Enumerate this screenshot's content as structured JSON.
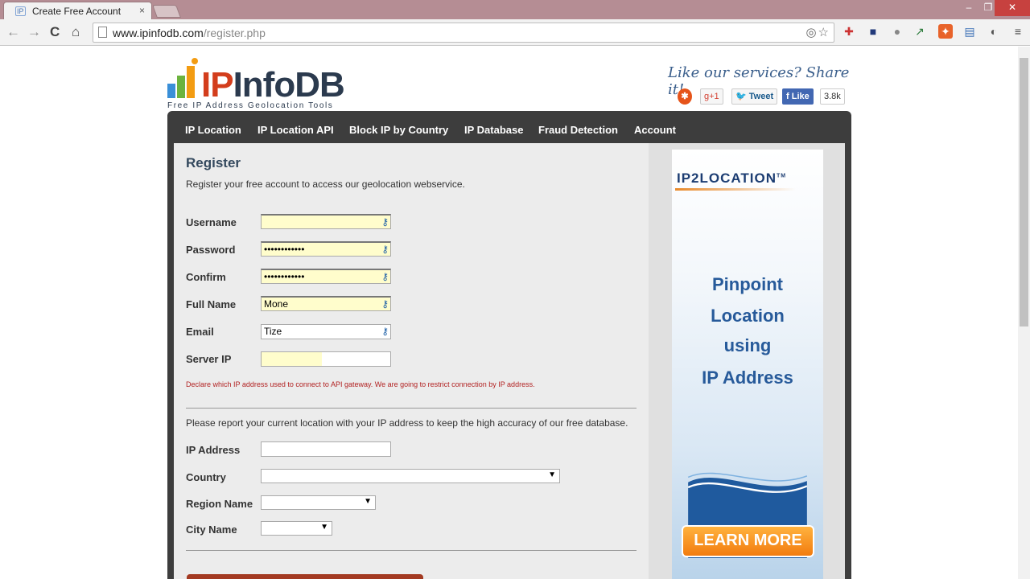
{
  "browser": {
    "tab_title": "Create Free Account",
    "tab_favicon": "IP",
    "tab_close": "×",
    "url_host": "www.ipinfodb.com",
    "url_path": "/register.php",
    "window_controls": {
      "minimize": "–",
      "maximize": "❐",
      "close": "✕"
    }
  },
  "header": {
    "logo_ip": "IP",
    "logo_rest": "InfoDB",
    "tagline": "Free IP Address Geolocation Tools",
    "share_title": "Like our services? Share it!",
    "share_buttons": {
      "gplus": "g+1",
      "tweet": "Tweet",
      "like": "Like",
      "like_count": "3.8k"
    }
  },
  "nav": {
    "items": [
      "IP Location",
      "IP Location API",
      "Block IP by Country",
      "IP Database",
      "Fraud Detection",
      "Account"
    ]
  },
  "form": {
    "heading": "Register",
    "subheading": "Register your free account to access our geolocation webservice.",
    "labels": {
      "username": "Username",
      "password": "Password",
      "confirm": "Confirm",
      "full_name": "Full Name",
      "email": "Email",
      "server_ip": "Server IP"
    },
    "values": {
      "username": "",
      "password": "••••••••••••",
      "confirm": "••••••••••••",
      "full_name": "Mone",
      "email": "Tize",
      "server_ip": ""
    },
    "server_ip_note": "Declare which IP address used to connect to API gateway. We are going to restrict connection by IP address.",
    "report_text": "Please report your current location with your IP address to keep the high accuracy of our free database.",
    "location_labels": {
      "ip_address": "IP Address",
      "country": "Country",
      "region_name": "Region Name",
      "city_name": "City Name"
    },
    "location_values": {
      "ip_address": "",
      "country": "",
      "region_name": "",
      "city_name": ""
    }
  },
  "ad": {
    "brand": "IP2LOCATION",
    "brand_tm": "TM",
    "line1": "Pinpoint",
    "line2": "Location",
    "line3": "using",
    "line4": "IP Address",
    "cta": "LEARN MORE"
  },
  "colors": {
    "titlebar": "#b58d94",
    "navbar": "#3d3d3d",
    "autofill": "#fffdcc",
    "note": "#b22222",
    "cta": "#f27c0f"
  }
}
